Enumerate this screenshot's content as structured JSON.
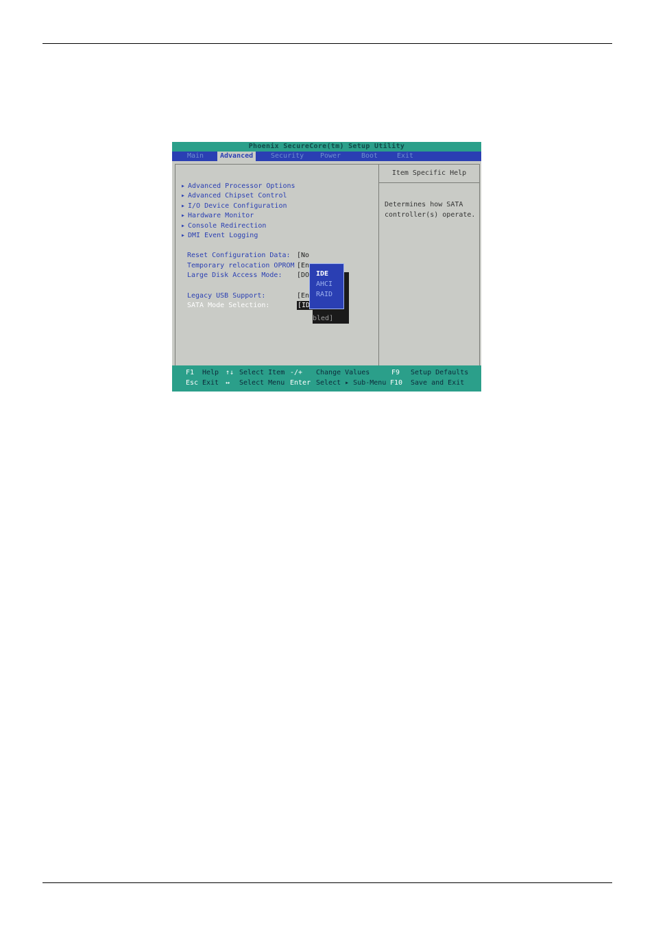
{
  "bios": {
    "title": "Phoenix SecureCore(tm) Setup Utility",
    "menu": [
      {
        "label": "Main"
      },
      {
        "label": "Advanced"
      },
      {
        "label": "Security"
      },
      {
        "label": "Power"
      },
      {
        "label": "Boot"
      },
      {
        "label": "Exit"
      }
    ],
    "submenus": [
      "Advanced Processor Options",
      "Advanced Chipset Control",
      "I/O Device Configuration",
      "Hardware Monitor",
      "Console Redirection",
      "DMI Event Logging"
    ],
    "settings": [
      {
        "label": "Reset Configuration Data:",
        "value": "[No"
      },
      {
        "label": "Temporary relocation OPROM",
        "value": "[En"
      },
      {
        "label": "Large Disk Access Mode:",
        "value": "[DO"
      },
      {
        "label": "Legacy USB Support:",
        "value": "[Ena"
      },
      {
        "label": "SATA Mode Selection:",
        "value": "[IDE]"
      }
    ],
    "popup": {
      "options": [
        "IDE",
        "AHCI",
        "RAID"
      ],
      "trailing": "bled]"
    },
    "help": {
      "title": "Item Specific Help",
      "lines": [
        "Determines how SATA",
        "controller(s) operate."
      ]
    },
    "footer": {
      "row1": [
        {
          "key": "F1",
          "desc": "Help"
        },
        {
          "key": "↑↓",
          "desc": "Select Item"
        },
        {
          "key": "-/+",
          "desc": "Change Values"
        },
        {
          "key": "F9",
          "desc": "Setup Defaults"
        }
      ],
      "row2": [
        {
          "key": "Esc",
          "desc": "Exit"
        },
        {
          "key": "↔",
          "desc": "Select Menu"
        },
        {
          "key": "Enter",
          "desc": "Select ▸ Sub-Menu"
        },
        {
          "key": "F10",
          "desc": "Save and Exit"
        }
      ]
    },
    "colors": {
      "title_bar": "#2b9f8a",
      "menu_bar": "#2a3fb3",
      "background": "#c9cbc6"
    }
  }
}
